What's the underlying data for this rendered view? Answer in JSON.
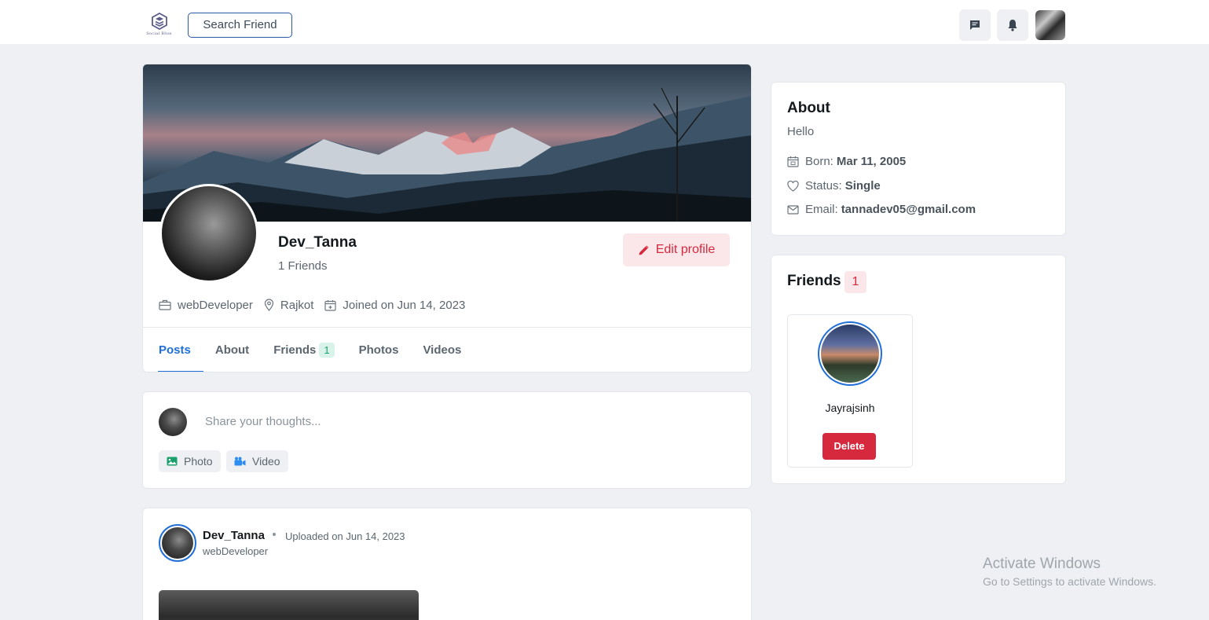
{
  "navbar": {
    "logo_text": "Social Bliss",
    "search_label": "Search Friend",
    "icons": [
      "chat-icon",
      "bell-icon"
    ]
  },
  "profile": {
    "name": "Dev_Tanna",
    "friends_label": "1 Friends",
    "edit_label": "Edit profile",
    "role": "webDeveloper",
    "location": "Rajkot",
    "joined": "Joined on Jun 14, 2023",
    "tabs": [
      {
        "label": "Posts",
        "active": true
      },
      {
        "label": "About"
      },
      {
        "label": "Friends",
        "badge": "1"
      },
      {
        "label": "Photos"
      },
      {
        "label": "Videos"
      }
    ]
  },
  "share": {
    "placeholder": "Share your thoughts...",
    "photo_label": "Photo",
    "video_label": "Video"
  },
  "post": {
    "author": "Dev_Tanna",
    "date": "Uploaded on Jun 14, 2023",
    "role": "webDeveloper"
  },
  "about": {
    "title": "About",
    "description": "Hello",
    "born_label": "Born:",
    "born_value": "Mar 11, 2005",
    "status_label": "Status:",
    "status_value": "Single",
    "email_label": "Email:",
    "email_value": "tannadev05@gmail.com"
  },
  "friends": {
    "title": "Friends",
    "count": "1",
    "items": [
      {
        "name": "Jayrajsinh",
        "action": "Delete"
      }
    ]
  },
  "watermark": {
    "title": "Activate Windows",
    "subtitle": "Go to Settings to activate Windows."
  },
  "colors": {
    "accent": "#1f6fd6",
    "danger": "#d6293e",
    "success": "#19a06c"
  }
}
